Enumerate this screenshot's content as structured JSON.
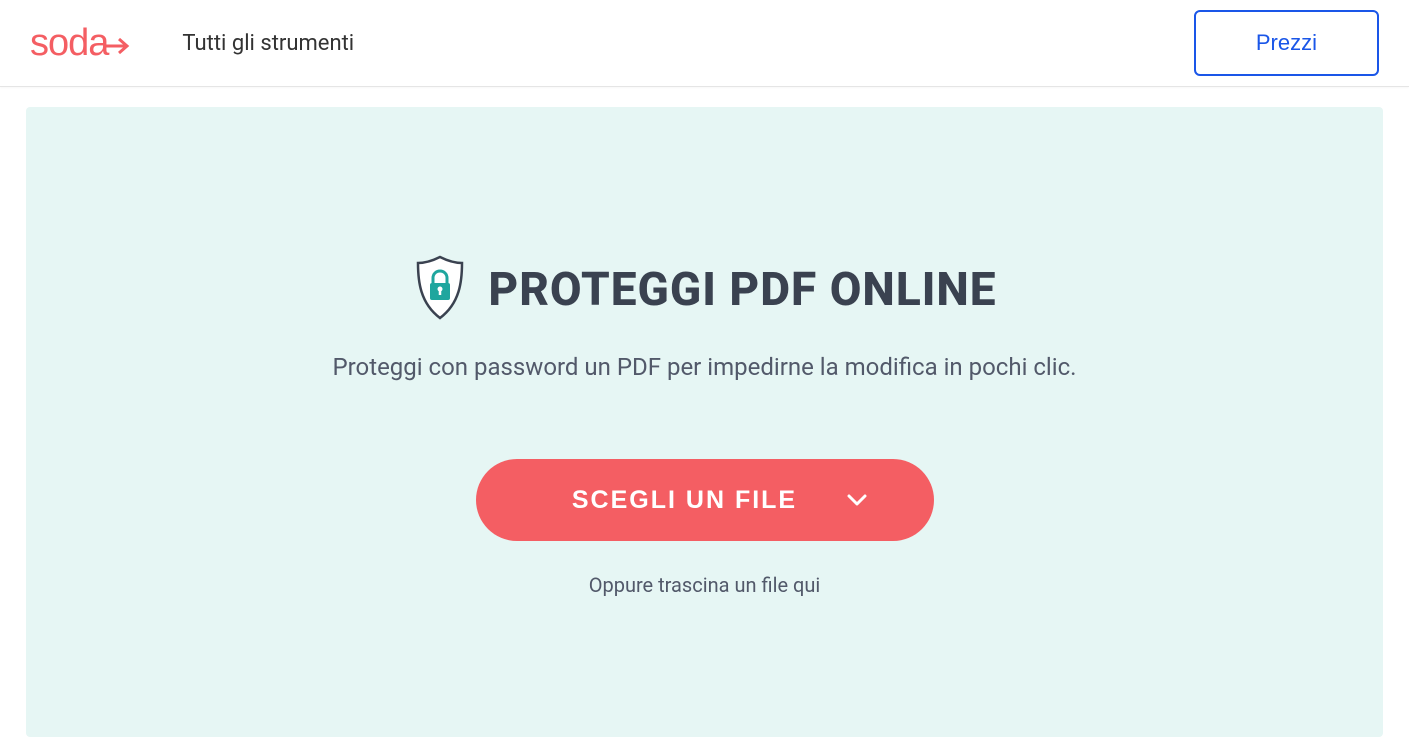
{
  "header": {
    "logo_text": "soda",
    "nav_tools_label": "Tutti gli strumenti",
    "pricing_label": "Prezzi"
  },
  "main": {
    "title": "PROTEGGI PDF ONLINE",
    "subtitle": "Proteggi con password un PDF per impedirne la modifica in pochi clic.",
    "choose_file_label": "SCEGLI UN FILE",
    "drag_hint": "Oppure trascina un file qui"
  },
  "colors": {
    "brand": "#f45e63",
    "accent": "#1a56e8",
    "panel": "#e6f6f4",
    "teal": "#1fa69e"
  }
}
